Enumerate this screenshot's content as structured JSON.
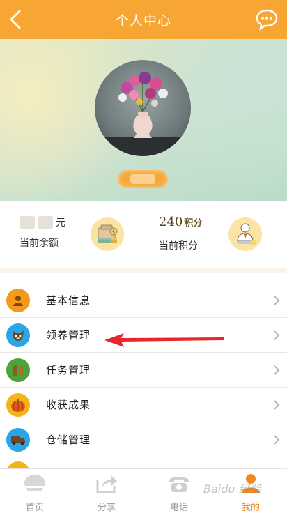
{
  "header": {
    "title": "个人中心",
    "back_icon": "back-icon",
    "chat_icon": "chat-icon",
    "color": "#f7a533"
  },
  "profile": {
    "avatar_icon": "flower-vase-avatar",
    "name": ""
  },
  "stats": {
    "balance": {
      "value_suffix": "元",
      "label": "当前余额",
      "icon": "wallet-money-icon"
    },
    "points": {
      "value": "240",
      "unit": "积分",
      "label": "当前积分",
      "icon": "user-award-icon"
    }
  },
  "menu": {
    "items": [
      {
        "label": "基本信息",
        "icon": "person-icon",
        "color": "#f39a1b"
      },
      {
        "label": "领养管理",
        "icon": "animal-icon",
        "color": "#2aa6e8"
      },
      {
        "label": "任务管理",
        "icon": "book-icon",
        "color": "#4aa43a"
      },
      {
        "label": "收获成果",
        "icon": "pumpkin-icon",
        "color": "#f3b418"
      },
      {
        "label": "仓储管理",
        "icon": "truck-icon",
        "color": "#2aa6e8"
      }
    ]
  },
  "tabbar": {
    "items": [
      {
        "label": "首页",
        "icon": "home-icon"
      },
      {
        "label": "分享",
        "icon": "share-icon"
      },
      {
        "label": "电话",
        "icon": "phone-icon"
      },
      {
        "label": "我的",
        "icon": "me-icon"
      }
    ],
    "active_index": 3,
    "active_color": "#f08a1c"
  },
  "watermark": "Baidu 经验"
}
